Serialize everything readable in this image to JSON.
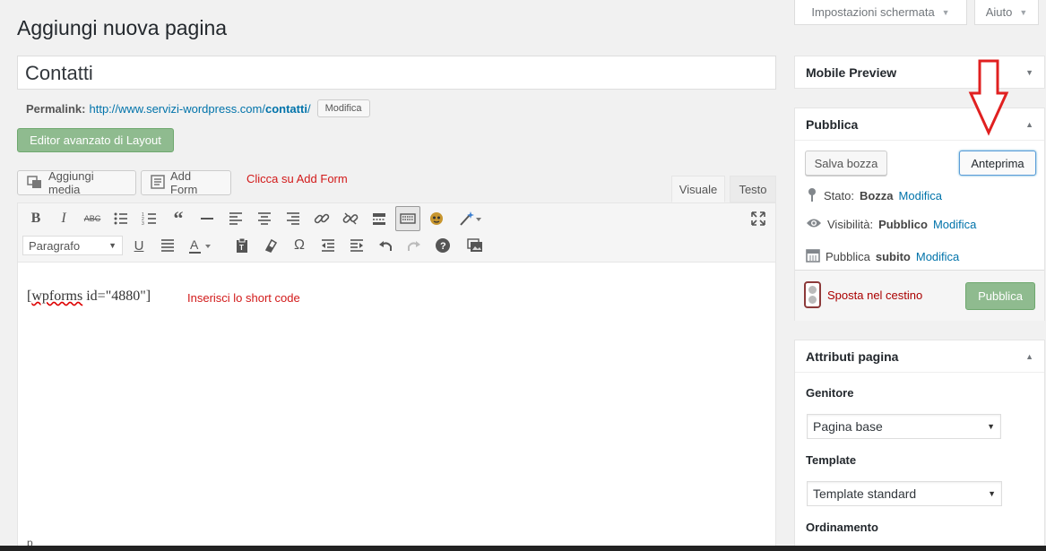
{
  "screen_options": "Impostazioni schermata",
  "help": "Aiuto",
  "page_title": "Aggiungi nuova pagina",
  "post_title": "Contatti",
  "permalink": {
    "label": "Permalink:",
    "url_base": "http://www.servizi-wordpress.com/",
    "slug": "contatti",
    "trailing": "/",
    "edit_button": "Modifica"
  },
  "layout_button": "Editor avanzato di Layout",
  "media_button": "Aggiungi media",
  "form_button": "Add Form",
  "annotation_add_form": "Clicca su Add Form",
  "tabs": {
    "visual": "Visuale",
    "text": "Testo"
  },
  "format_select": "Paragrafo",
  "content": {
    "shortcode_word": "wpforms",
    "shortcode_rest": " id=\"4880\"]",
    "shortcode_open": "["
  },
  "annotation_shortcode": "Inserisci lo short code",
  "status_path": "p",
  "mobile_preview": {
    "title": "Mobile Preview"
  },
  "publish": {
    "title": "Pubblica",
    "save_draft": "Salva bozza",
    "preview": "Anteprima",
    "status_label": "Stato:",
    "status_value": "Bozza",
    "visibility_label": "Visibilità:",
    "visibility_value": "Pubblico",
    "schedule_label": "Pubblica",
    "schedule_value": "subito",
    "edit_link": "Modifica",
    "trash": "Sposta nel cestino",
    "publish_button": "Pubblica"
  },
  "page_attributes": {
    "title": "Attributi pagina",
    "parent_label": "Genitore",
    "parent_value": "Pagina base",
    "template_label": "Template",
    "template_value": "Template standard",
    "order_label": "Ordinamento"
  },
  "colors": {
    "accent_link": "#0073aa",
    "annotation_red": "#d21919",
    "green_button": "#8fbb8f"
  },
  "icons": [
    "media-icon",
    "form-icon",
    "bold-icon",
    "italic-icon",
    "strikethrough-icon",
    "pin-icon",
    "eye-icon",
    "calendar-icon",
    "red-arrow-down-icon"
  ]
}
